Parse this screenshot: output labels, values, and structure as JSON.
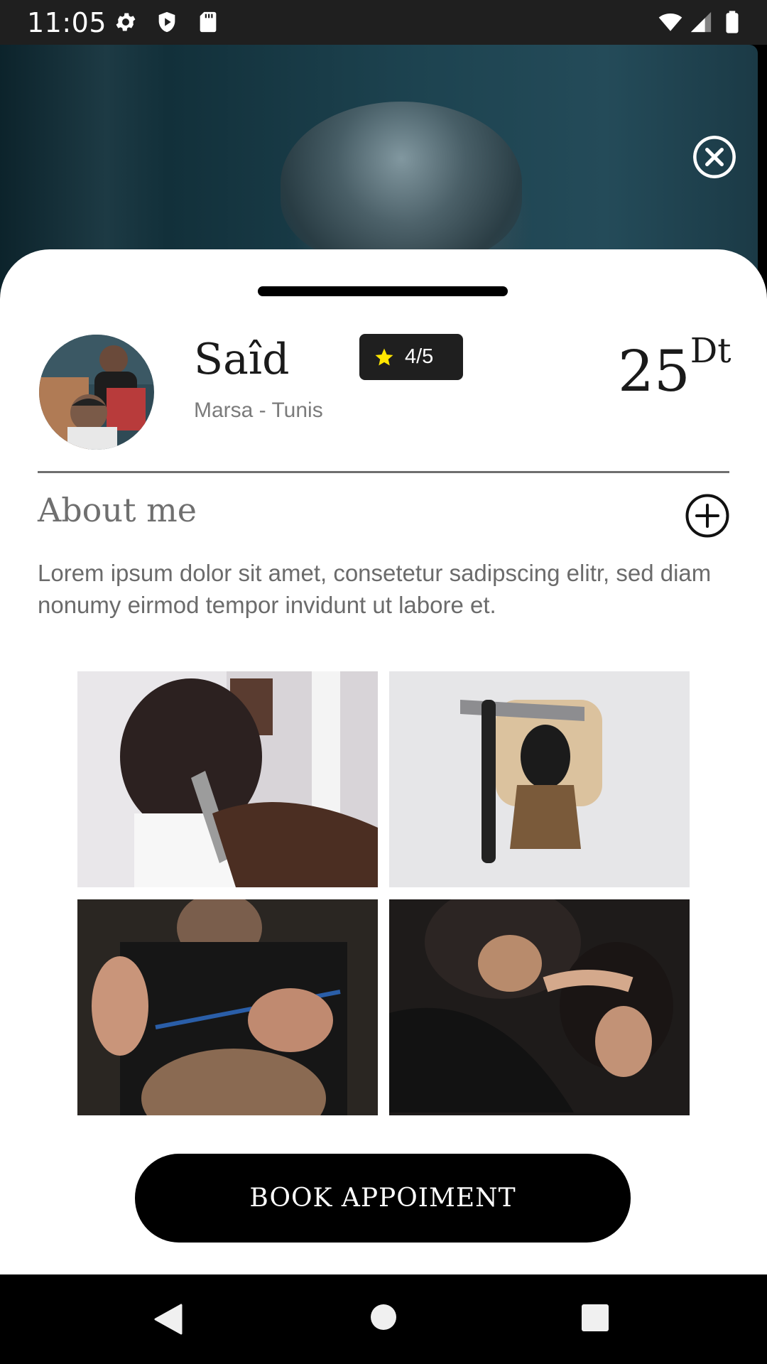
{
  "status_bar": {
    "time": "11:05",
    "left_icons": [
      "settings-icon",
      "shield-icon",
      "sd-card-icon"
    ],
    "right_icons": [
      "wifi-icon",
      "signal-icon",
      "battery-icon"
    ]
  },
  "hero": {
    "image": "barber-haircut-photo",
    "close_icon": "close-circle-icon"
  },
  "profile": {
    "name": "Saîd",
    "location": "Marsa - Tunis",
    "rating": "4/5",
    "rating_icon": "star-icon",
    "rating_color": "#FFE600",
    "price_amount": "25",
    "price_unit": "Dt"
  },
  "about": {
    "title": "About me",
    "expand_icon": "plus-circle-icon",
    "text": "Lorem ipsum dolor sit amet, consetetur sadipscing elitr, sed diam nonumy eirmod tempor invidunt ut labore et."
  },
  "gallery": [
    {
      "image": "clipper-haircut-photo"
    },
    {
      "image": "razor-and-brush-photo"
    },
    {
      "image": "scissors-cut-photo"
    },
    {
      "image": "barber-trimming-photo"
    }
  ],
  "cta": {
    "book_label": "BOOK APPOIMENT"
  },
  "nav_bar": {
    "icons": [
      "back-icon",
      "home-icon",
      "recents-icon"
    ]
  },
  "colors": {
    "accent": "#000000",
    "sheet": "#FFFFFF",
    "muted_text": "#6B6B6B"
  }
}
